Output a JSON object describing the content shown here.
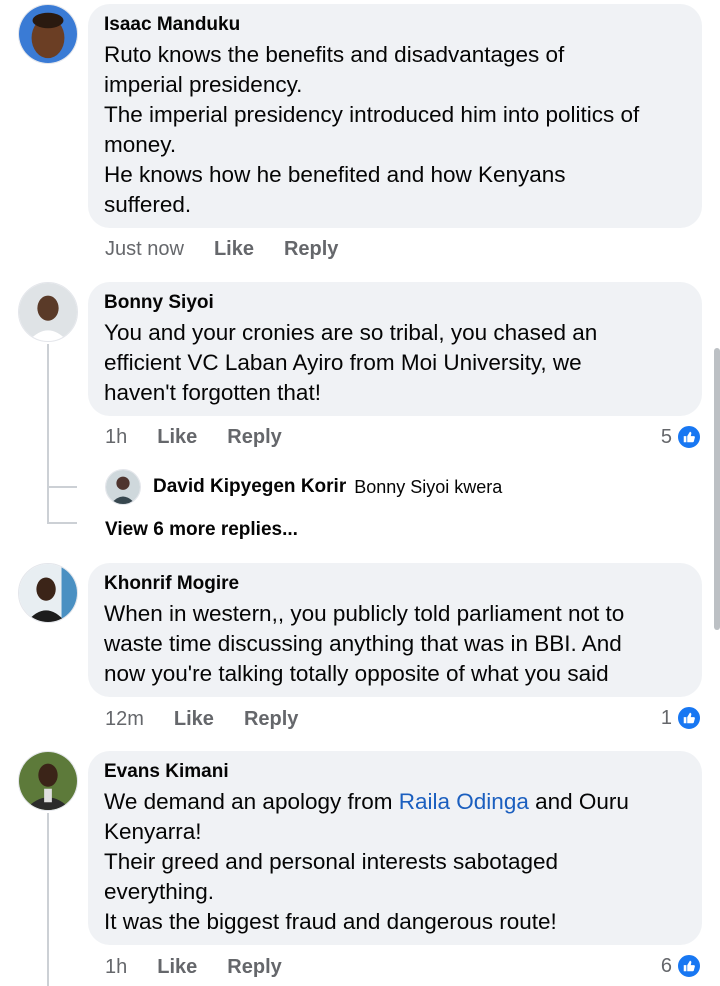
{
  "comments": [
    {
      "author": "Isaac Manduku",
      "lines": [
        "Ruto knows the benefits and disadvantages of",
        "imperial presidency.",
        "The imperial presidency introduced him into politics of",
        "money.",
        "He knows how he benefited and how Kenyans",
        "suffered."
      ],
      "time": "Just now",
      "like_label": "Like",
      "reply_label": "Reply",
      "avatar_icon": "profile-photo-icon"
    },
    {
      "author": "Bonny Siyoi",
      "lines": [
        "You and your cronies are so tribal, you chased an",
        "efficient VC Laban Ayiro from Moi University, we",
        "haven't forgotten that!"
      ],
      "time": "1h",
      "like_label": "Like",
      "reply_label": "Reply",
      "reaction_count": "5",
      "reply_preview": {
        "author": "David Kipyegen Korir",
        "text": "Bonny Siyoi kwera"
      },
      "view_more": "View 6 more replies..."
    },
    {
      "author": "Khonrif Mogire",
      "lines": [
        "When in western,, you publicly told parliament not to",
        "waste time discussing anything that was in BBI. And",
        "now you're talking totally opposite of what you said"
      ],
      "time": "12m",
      "like_label": "Like",
      "reply_label": "Reply",
      "reaction_count": "1"
    },
    {
      "author": "Evans Kimani",
      "line1_before": "We demand an apology from ",
      "line1_mention": "Raila Odinga",
      "line1_after": " and Ouru",
      "lines": [
        "Kenyarra!",
        "Their greed and personal interests sabotaged",
        "everything.",
        "It was the biggest fraud and dangerous route!"
      ],
      "time": "1h",
      "like_label": "Like",
      "reply_label": "Reply",
      "reaction_count": "6"
    }
  ],
  "colors": {
    "bubble": "#f0f2f5",
    "mention": "#1b5fbf",
    "like_badge": "#1877f2",
    "muted_text": "#65676b"
  }
}
